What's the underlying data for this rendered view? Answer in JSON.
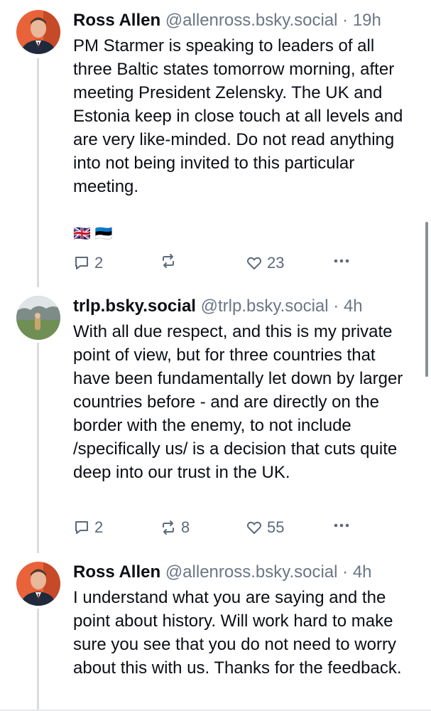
{
  "posts": [
    {
      "author": "Ross Allen",
      "handle": "@allenross.bsky.social",
      "separator": "·",
      "time": "19h",
      "text": "PM Starmer is speaking to leaders of all three Baltic states tomorrow morning, after meeting President Zelensky. The UK and Estonia keep in close touch at all levels and are very like-minded. Do not read anything into not being invited to this particular meeting.",
      "flags": [
        "🇬🇧",
        "🇪🇪"
      ],
      "replies": "2",
      "reposts": "",
      "likes": "23",
      "avatar": "profile-photo-man-suit"
    },
    {
      "author": "trlp.bsky.social",
      "handle": "@trlp.bsky.social",
      "separator": "·",
      "time": "4h",
      "text": "With all due respect, and this is my private point of view, but for three countries that have been fundamentally let down by larger countries before - and are directly on the border with the enemy, to not include /specifically us/ is a decision that cuts quite deep into our trust in the UK.",
      "replies": "2",
      "reposts": "8",
      "likes": "55",
      "avatar": "profile-photo-landscape-person"
    },
    {
      "author": "Ross Allen",
      "handle": "@allenross.bsky.social",
      "separator": "·",
      "time": "4h",
      "text": "I understand what you are saying and the point about history. Will work hard to make sure you see that you do not need to worry about this with us. Thanks for the feedback.",
      "avatar": "profile-photo-man-suit"
    }
  ],
  "icons": {
    "reply": "speech-bubble-icon",
    "repost": "repost-arrows-icon",
    "like": "heart-icon",
    "more": "ellipsis-icon"
  },
  "colors": {
    "text": "#0b0f14",
    "muted": "#6b7785",
    "icon": "#5b6a7b",
    "thread_line": "#d9dde2",
    "avatar_bg": "#e8633a"
  }
}
